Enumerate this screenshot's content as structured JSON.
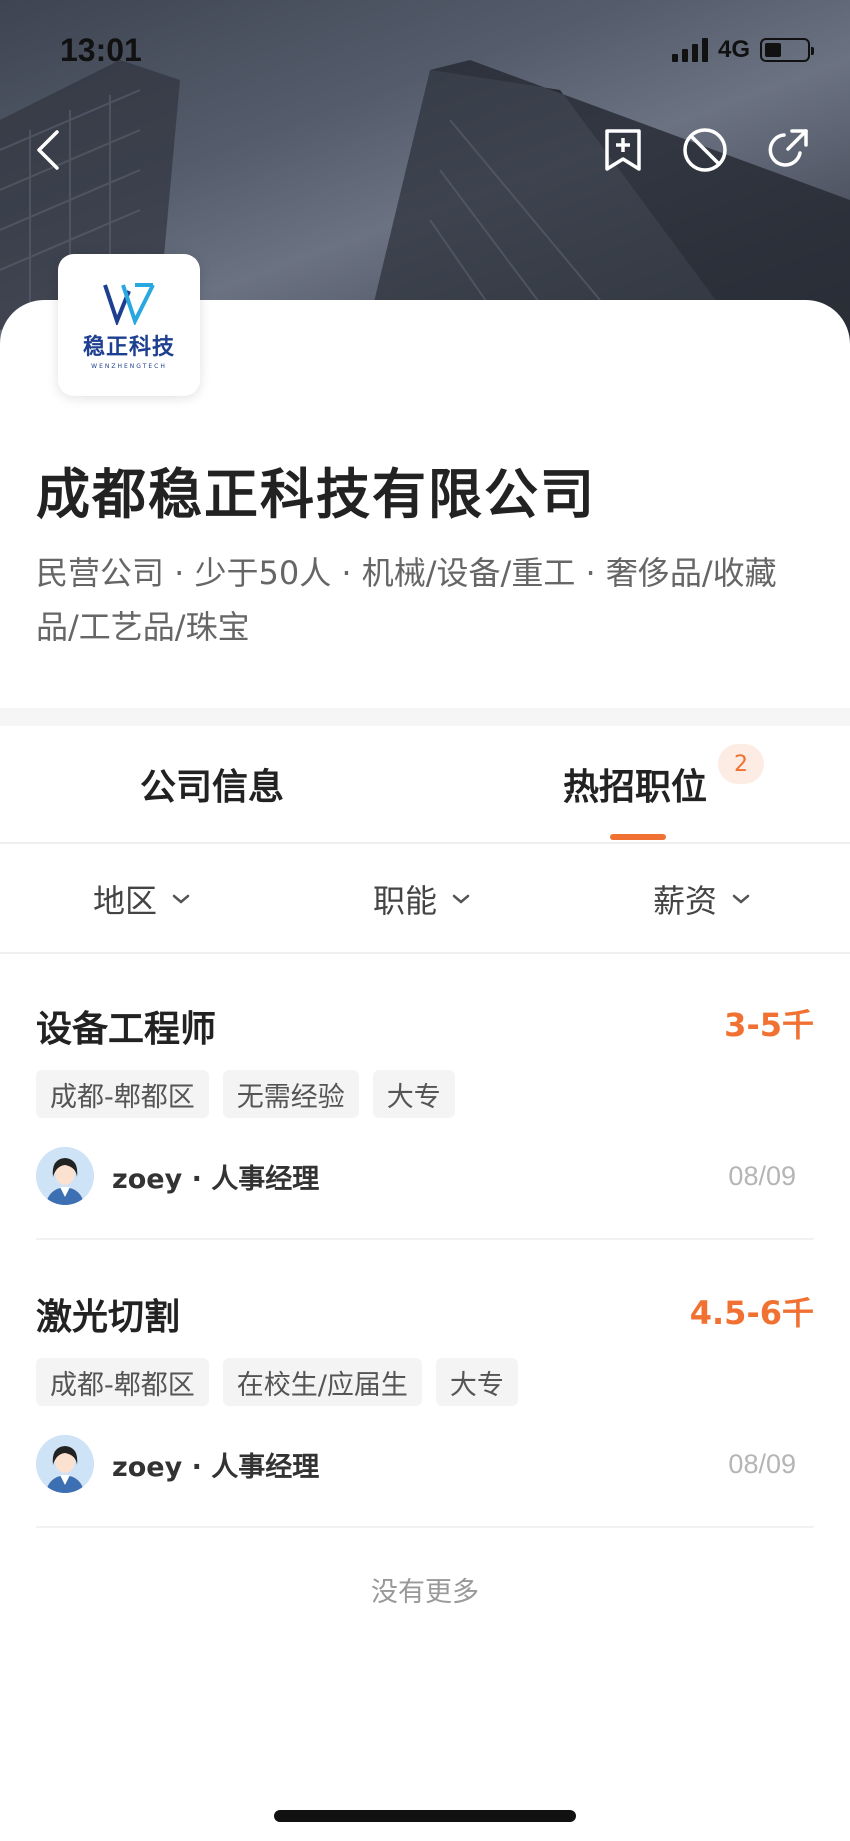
{
  "status": {
    "time": "13:01",
    "network": "4G"
  },
  "nav": {
    "back_icon": "back-icon",
    "bookmark_icon": "bookmark-add-icon",
    "block_icon": "block-icon",
    "share_icon": "share-icon"
  },
  "company": {
    "logo_text": "稳正科技",
    "logo_sub": "WENZHENGTECH",
    "name": "成都稳正科技有限公司",
    "meta": "民营公司 · 少于50人 · 机械/设备/重工 · 奢侈品/收藏品/工艺品/珠宝"
  },
  "tabs": {
    "info": "公司信息",
    "jobs": "热招职位",
    "jobs_count": "2"
  },
  "filters": {
    "region": "地区",
    "function": "职能",
    "salary": "薪资"
  },
  "jobs": [
    {
      "title": "设备工程师",
      "salary": "3-5千",
      "tags": [
        "成都-郫都区",
        "无需经验",
        "大专"
      ],
      "recruiter": "zoey · 人事经理",
      "date": "08/09"
    },
    {
      "title": "激光切割",
      "salary": "4.5-6千",
      "tags": [
        "成都-郫都区",
        "在校生/应届生",
        "大专"
      ],
      "recruiter": "zoey · 人事经理",
      "date": "08/09"
    }
  ],
  "footer": {
    "no_more": "没有更多"
  },
  "colors": {
    "accent": "#f07131",
    "logo_blue": "#1d3f8f"
  }
}
